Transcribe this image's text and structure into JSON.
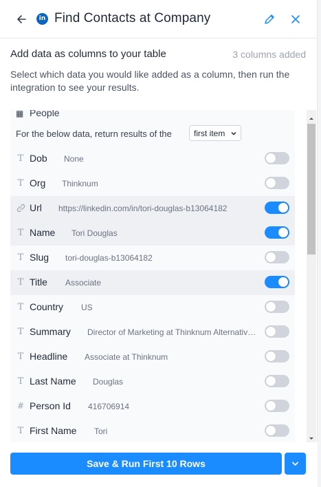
{
  "header": {
    "title": "Find Contacts at Company",
    "logo_text": "in",
    "icons": {
      "back": "arrow-left-icon",
      "edit": "pencil-icon",
      "close": "close-icon"
    }
  },
  "columns": {
    "heading": "Add data as columns to your table",
    "count_label": "3 columns added",
    "description": "Select which data you would like added as a column, then run the integration to see your results."
  },
  "group": {
    "label": "People",
    "return_label": "For the below data, return results of the",
    "select_value": "first item"
  },
  "rows": [
    {
      "icon": "T",
      "name": "Dob",
      "value": "None",
      "on": false,
      "highlight": false
    },
    {
      "icon": "T",
      "name": "Org",
      "value": "Thinknum",
      "on": false,
      "highlight": false
    },
    {
      "icon": "link",
      "name": "Url",
      "value": "https://linkedin.com/in/tori-douglas-b13064182",
      "on": true,
      "highlight": true
    },
    {
      "icon": "T",
      "name": "Name",
      "value": "Tori Douglas",
      "on": true,
      "highlight": true
    },
    {
      "icon": "T",
      "name": "Slug",
      "value": "tori-douglas-b13064182",
      "on": false,
      "highlight": false
    },
    {
      "icon": "T",
      "name": "Title",
      "value": "Associate",
      "on": true,
      "highlight": true
    },
    {
      "icon": "T",
      "name": "Country",
      "value": "US",
      "on": false,
      "highlight": false
    },
    {
      "icon": "T",
      "name": "Summary",
      "value": "Director of Marketing at Thinknum Alternative ...",
      "on": false,
      "highlight": false
    },
    {
      "icon": "T",
      "name": "Headline",
      "value": "Associate at Thinknum",
      "on": false,
      "highlight": false
    },
    {
      "icon": "T",
      "name": "Last Name",
      "value": "Douglas",
      "on": false,
      "highlight": false
    },
    {
      "icon": "#",
      "name": "Person Id",
      "value": "416706914",
      "on": false,
      "highlight": false
    },
    {
      "icon": "T",
      "name": "First Name",
      "value": "Tori",
      "on": false,
      "highlight": false
    }
  ],
  "footer": {
    "save_label": "Save & Run First 10 Rows"
  },
  "colors": {
    "accent": "#1a8cff",
    "linkedin": "#0a66c2",
    "toggle_off": "#d1d5db",
    "row_highlight": "#eef0f3"
  }
}
